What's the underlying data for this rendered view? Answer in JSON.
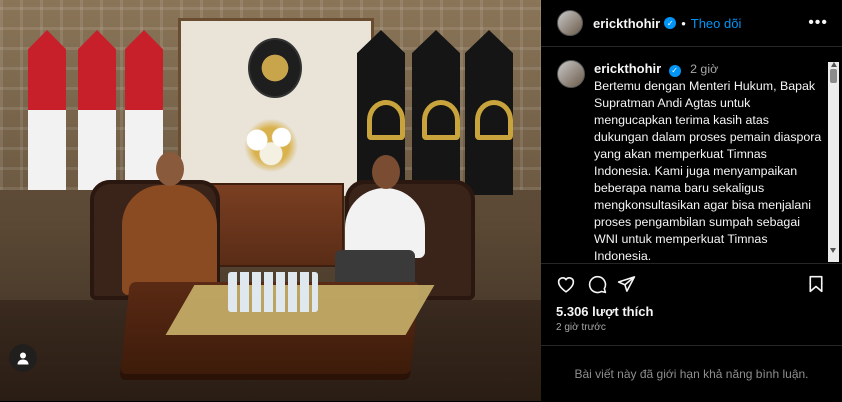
{
  "post": {
    "username": "erickthohir",
    "follow_label": "Theo dõi",
    "separator": "•",
    "more_label": "•••",
    "time_short": "2 giờ",
    "caption": "Bertemu dengan Menteri Hukum, Bapak Supratman Andi Agtas untuk mengucapkan terima kasih atas dukungan dalam proses pemain diaspora yang akan memperkuat Timnas Indonesia. Kami juga menyampaikan beberapa nama baru sekaligus mengkonsultasikan agar bisa menjalani proses pengambilan sumpah sebagai WNI untuk memperkuat Timnas Indonesia.",
    "likes": "5.306 lượt thích",
    "time_ago": "2 giờ trước",
    "comments_limited": "Bài viết này đã giới hạn khả năng bình luận."
  },
  "icons": {
    "verified": "verified-badge-icon",
    "like": "heart-icon",
    "comment": "comment-icon",
    "share": "share-icon",
    "save": "bookmark-icon",
    "tagged": "user-tag-icon"
  },
  "colors": {
    "background": "#000000",
    "accent": "#0095f6",
    "text": "#f5f5f5",
    "muted": "#a8a8a8"
  }
}
